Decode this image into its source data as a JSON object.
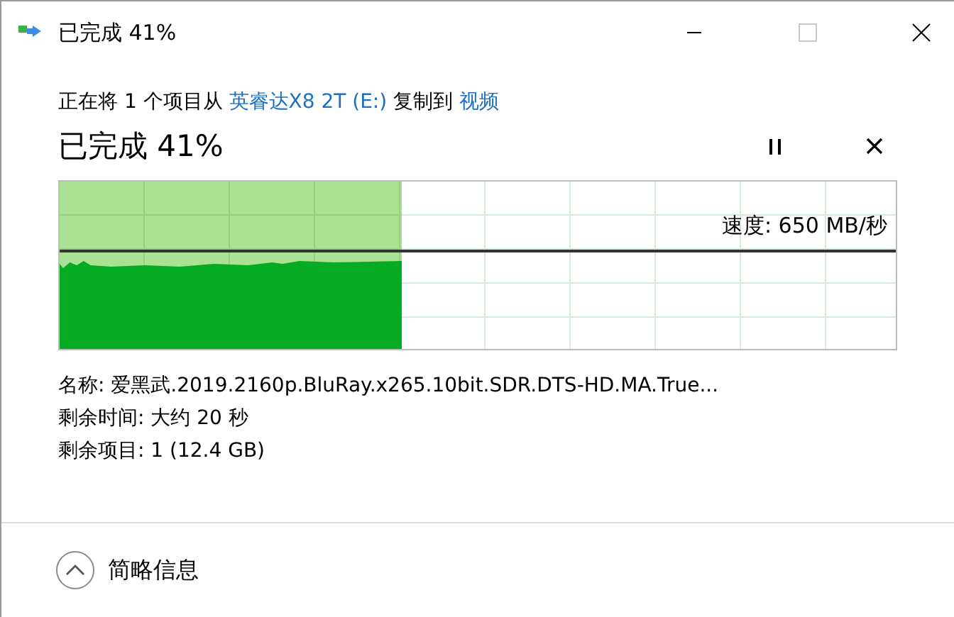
{
  "window": {
    "title": "已完成 41%"
  },
  "copy_summary": {
    "prefix": "正在将 1 个项目从",
    "source": "英睿达X8 2T (E:)",
    "middle": "复制到",
    "destination": "视频"
  },
  "status": "已完成 41%",
  "progress": {
    "level": 0.41,
    "speed": "速度: 650 MB/秒"
  },
  "details": [
    "名称: 爱黑武.2019.2160p.BluRay.x265.10bit.SDR.DTS-HD.MA.True...",
    "剩余时间: 大约 20 秒",
    "剩余项目: 1 (12.4 GB)"
  ],
  "footer": {
    "label": "简略信息",
    "expanded": true
  }
}
